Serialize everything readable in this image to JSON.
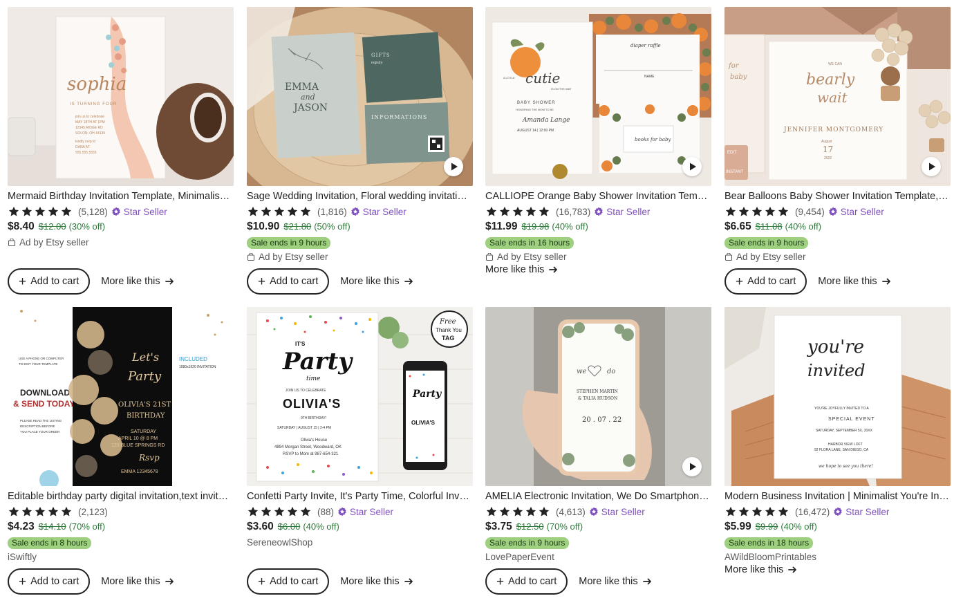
{
  "icons": {
    "star": "star-icon",
    "star_seller_badge": "star-seller-badge-icon",
    "ad": "ad-icon",
    "play": "play-icon",
    "plus": "plus-icon",
    "arrow": "arrow-right-icon"
  },
  "colors": {
    "star_fill": "#222222",
    "star_seller": "#7f4fbf",
    "discount_green": "#2d7a3a",
    "sale_badge_bg": "#9ed080",
    "button_border": "#222222"
  },
  "labels": {
    "add_to_cart": "Add to cart",
    "more_like_this": "More like this",
    "star_seller": "Star Seller",
    "ad_by_etsy_seller": "Ad by Etsy seller"
  },
  "listings": [
    {
      "title": "Mermaid Birthday Invitation Template, Minimalist Mermaid Tail...",
      "stars": 5,
      "reviews": "(5,128)",
      "star_seller": true,
      "price": "$8.40",
      "original_price": "$12.00",
      "discount": "(30% off)",
      "sale_badge": "",
      "shop": "Ad by Etsy seller",
      "is_ad": true,
      "has_video": false,
      "show_add_to_cart": true
    },
    {
      "title": "Sage Wedding Invitation, Floral wedding invitation template",
      "stars": 5,
      "reviews": "(1,816)",
      "star_seller": true,
      "price": "$10.90",
      "original_price": "$21.80",
      "discount": "(50% off)",
      "sale_badge": "Sale ends in 9 hours",
      "shop": "Ad by Etsy seller",
      "is_ad": true,
      "has_video": true,
      "show_add_to_cart": true
    },
    {
      "title": "CALLIOPE Orange Baby Shower Invitation Template, Editable",
      "stars": 5,
      "reviews": "(16,783)",
      "star_seller": true,
      "price": "$11.99",
      "original_price": "$19.98",
      "discount": "(40% off)",
      "sale_badge": "Sale ends in 16 hours",
      "shop": "Ad by Etsy seller",
      "is_ad": true,
      "has_video": true,
      "show_add_to_cart": false
    },
    {
      "title": "Bear Balloons Baby Shower Invitation Template, Editable",
      "stars": 5,
      "reviews": "(9,454)",
      "star_seller": true,
      "price": "$6.65",
      "original_price": "$11.08",
      "discount": "(40% off)",
      "sale_badge": "Sale ends in 9 hours",
      "shop": "Ad by Etsy seller",
      "is_ad": true,
      "has_video": true,
      "show_add_to_cart": true
    },
    {
      "title": "Editable birthday party digital invitation,text invitation",
      "stars": 5,
      "reviews": "(2,123)",
      "star_seller": false,
      "price": "$4.23",
      "original_price": "$14.10",
      "discount": "(70% off)",
      "sale_badge": "Sale ends in 8 hours",
      "shop": "iSwiftly",
      "is_ad": false,
      "has_video": false,
      "show_add_to_cart": true
    },
    {
      "title": "Confetti Party Invite, It's Party Time, Colorful Invitation",
      "stars": 5,
      "reviews": "(88)",
      "star_seller": true,
      "price": "$3.60",
      "original_price": "$6.00",
      "discount": "(40% off)",
      "sale_badge": "",
      "shop": "SereneowlShop",
      "is_ad": false,
      "has_video": false,
      "show_add_to_cart": true
    },
    {
      "title": "AMELIA Electronic Invitation, We Do Smartphone Invitation",
      "stars": 5,
      "reviews": "(4,613)",
      "star_seller": true,
      "price": "$3.75",
      "original_price": "$12.50",
      "discount": "(70% off)",
      "sale_badge": "Sale ends in 9 hours",
      "shop": "LovePaperEvent",
      "is_ad": false,
      "has_video": true,
      "show_add_to_cart": true
    },
    {
      "title": "Modern Business Invitation | Minimalist You're Invited Template",
      "stars": 5,
      "reviews": "(16,472)",
      "star_seller": true,
      "price": "$5.99",
      "original_price": "$9.99",
      "discount": "(40% off)",
      "sale_badge": "Sale ends in 18 hours",
      "shop": "AWildBloomPrintables",
      "is_ad": false,
      "has_video": false,
      "show_add_to_cart": false
    }
  ],
  "thumbnails": [
    {
      "card_text": [
        "sophia",
        "IS TURNING FOUR",
        "join us to celebrate",
        "MAY 18TH AT 1PM",
        "12345 RIDGE RD",
        "SOLON, OH 44139",
        "kindly rsvp to",
        "DANA AT",
        "555.555.5555"
      ]
    },
    {
      "card_text": [
        "EMMA",
        "and",
        "JASON",
        "GIFTS",
        "registry",
        "INFORMATIONS"
      ]
    },
    {
      "card_text": [
        "A LITTLE",
        "cutie",
        "IS ON THE WAY",
        "BABY SHOWER",
        "HONORING THE MOM TO BE",
        "Amanda Lange",
        "AUGUST 14 | 12:00 PM",
        "diaper raffle",
        "NAME",
        "books for baby"
      ]
    },
    {
      "card_text": [
        "for",
        "baby",
        "WE CAN",
        "bearly",
        "wait",
        "JENNIFER MONTGOMERY",
        "August",
        "17",
        "2022",
        "EDIT",
        "INSTANT"
      ]
    },
    {
      "card_text": [
        "USE A PHONE OR COMPUTER",
        "TO EDIT YOUR TEMPLATE",
        "DOWNLOAD",
        "& SEND TODAY!",
        "PLEASE READ THE LISTING",
        "DESCRIPTION BEFORE",
        "YOU PLACE YOUR ORDER",
        "Let's",
        "Party",
        "OLIVIA'S 21ST",
        "BIRTHDAY",
        "SATURDAY",
        "APRIL 10 @ 8 PM",
        "123 BLUE SPRINGS RD",
        "Rsvp",
        "EMMA 12345678",
        "INCLUDED",
        "1080x1920 INVITATION"
      ]
    },
    {
      "card_text": [
        "IT'S",
        "Party",
        "time",
        "JOIN US TO CELEBRATE",
        "OLIVIA'S",
        "9TH BIRTHDAY!",
        "SATURDAY | AUGUST 15 | 2-4 PM",
        "Olivia's House",
        "4894 Morgan Street, Woodward, OK",
        "RSVP to Mom at 987-654-321",
        "Free",
        "Thank You",
        "TAG"
      ]
    },
    {
      "card_text": [
        "we",
        "do",
        "STEPHEN MARTIN",
        "& TALIA HUDSON",
        "20 . 07 . 22"
      ]
    },
    {
      "card_text": [
        "you're",
        "invited",
        "YOU'RE JOYFULLY INVITED TO A",
        "SPECIAL EVENT",
        "SATURDAY, SEPTEMBER 5X, 20XX",
        "HARBOR VIEW LOFT",
        "92 FLORA LANE, SAN DIEGO, CA",
        "we hope to see you there!"
      ]
    }
  ]
}
